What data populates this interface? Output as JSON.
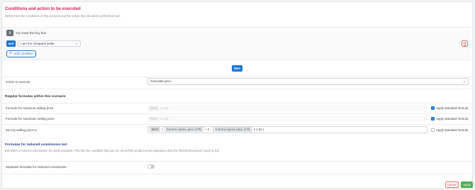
{
  "header": {
    "title": "Conditions and action to be executed",
    "subtitle": "Define here the conditions of this scenario and the action that should be performed next."
  },
  "conditions": {
    "if_badge": "if",
    "first_condition": "You have the buy box",
    "and_label": "and",
    "second_condition_value": "I am the cheapest seller",
    "add_condition_label": "Add condition"
  },
  "then_label": "then",
  "action": {
    "label": "Action to execute",
    "value": "Calculate price"
  },
  "regular_formulas": {
    "heading": "Regular formulas within this scenario",
    "rows": [
      {
        "label": "Formula for minimum selling price",
        "placeholder_chip": "Price",
        "placeholder_op": "x 4.00",
        "apply_label": "Apply standard formula",
        "apply_checked": true
      },
      {
        "label": "Formula for maximum selling price",
        "placeholder_chip": "Price",
        "placeholder_op": "x 4.00",
        "apply_label": "Apply standard formula",
        "apply_checked": true
      },
      {
        "label": "Set my selling price to",
        "formula": {
          "func": "MAX",
          "sep1": "(",
          "term1": "Current reprice price (CR)",
          "op1": "+ 2",
          "sep2": ";",
          "term2": "Current reprice price (CR)",
          "op2": "x 1.02 )"
        },
        "apply_label": "Apply standard formula",
        "apply_checked": false
      }
    ]
  },
  "reduced_commission": {
    "heading": "Formulas for reduced commission bol",
    "description": "Bol offers a reduced commission for some products. This has the condition that you do not sell the product more expensive than the 'threshold amount' used by bol.",
    "toggle_label": "Separate formulas for reduced commission",
    "toggle_on": false
  },
  "footer": {
    "cancel_label": "Cancel",
    "apply_label": "Apply"
  }
}
